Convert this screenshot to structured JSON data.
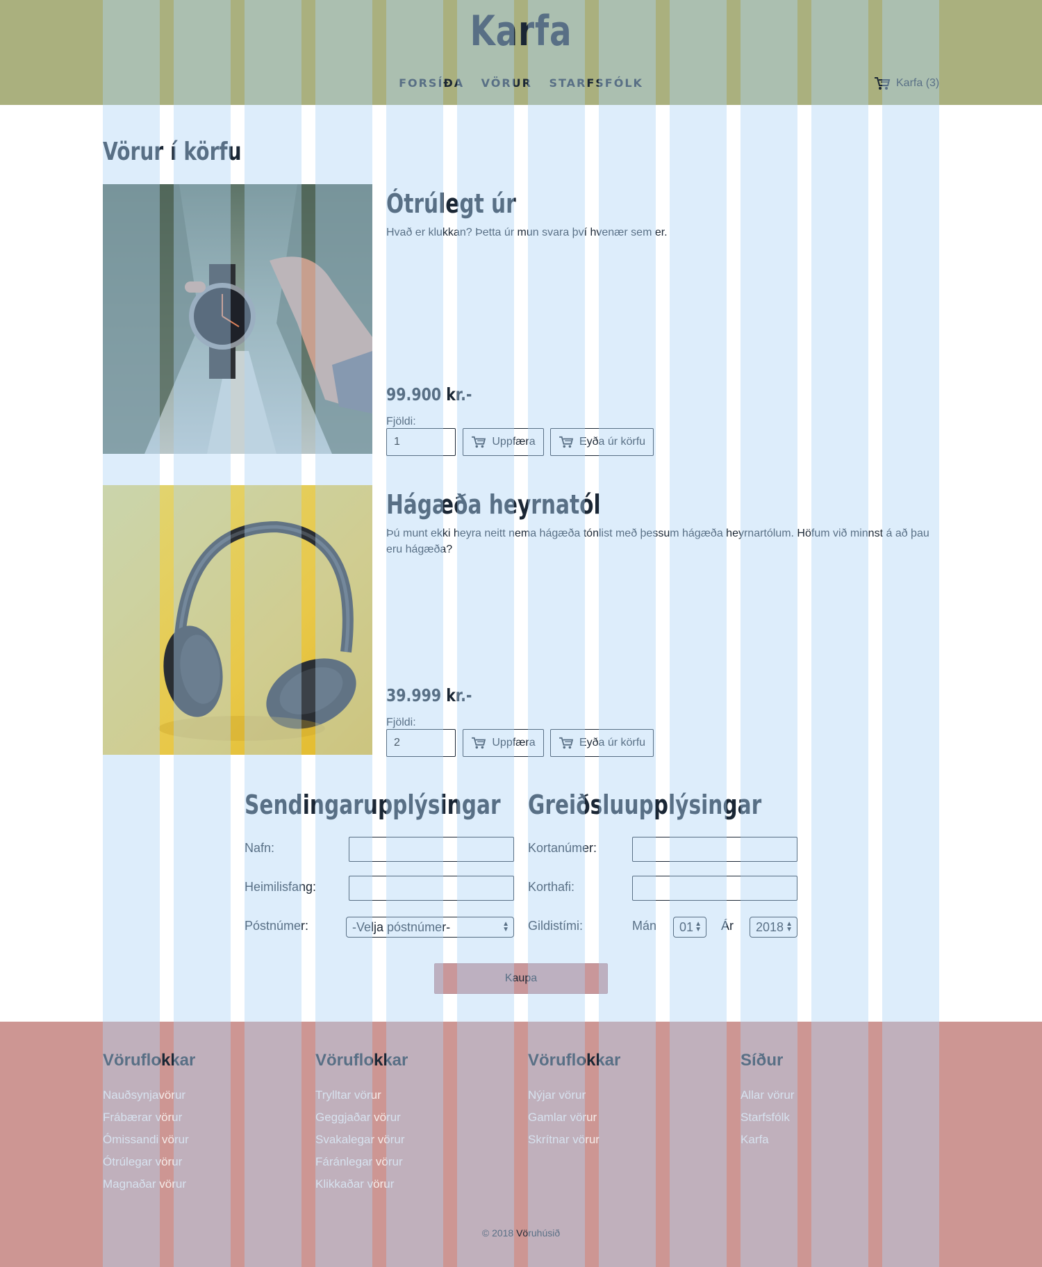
{
  "header": {
    "brand": "Karfa",
    "nav": [
      "FORSÍÐA",
      "VÖRUR",
      "STARFSFÓLK"
    ],
    "cart_label": "Karfa (3)"
  },
  "main": {
    "title": "Vörur í körfu",
    "products": [
      {
        "title": "Ótrúlegt úr",
        "description": "Hvað er klukkan? Þetta úr mun svara því hvenær sem er.",
        "price": "99.900 kr.-",
        "quantity_label": "Fjöldi:",
        "quantity": "1",
        "update_label": "Uppfæra",
        "remove_label": "Eyða úr körfu"
      },
      {
        "title": "Hágæða heyrnatól",
        "description": "Þú munt ekki heyra neitt nema hágæða tónlist með þessum hágæða heyrnartólum. Höfum við minnst á að þau eru hágæða?",
        "price": "39.999 kr.-",
        "quantity_label": "Fjöldi:",
        "quantity": "2",
        "update_label": "Uppfæra",
        "remove_label": "Eyða úr körfu"
      }
    ]
  },
  "shipping": {
    "title": "Sendingarupplýsingar",
    "name_label": "Nafn:",
    "address_label": "Heimilisfang:",
    "postcode_label": "Póstnúmer:",
    "postcode_value": "-Velja póstnúmer-"
  },
  "payment": {
    "title": "Greiðsluupplýsingar",
    "card_number_label": "Kortanúmer:",
    "card_holder_label": "Korthafi:",
    "expiry_label": "Gildistími:",
    "month_label": "Mán",
    "month_value": "01",
    "year_label": "Ár",
    "year_value": "2018"
  },
  "buy_label": "Kaupa",
  "footer": {
    "columns": [
      {
        "title": "Vöruflokkar",
        "links": [
          "Nauðsynjavörur",
          "Frábærar vörur",
          "Ómissandi vörur",
          "Ótrúlegar vörur",
          "Magnaðar vörur"
        ]
      },
      {
        "title": "Vöruflokkar",
        "links": [
          "Trylltar vörur",
          "Geggjaðar vörur",
          "Svakalegar vörur",
          "Fáránlegar vörur",
          "Klikkaðar vörur"
        ]
      },
      {
        "title": "Vöruflokkar",
        "links": [
          "Nýjar vörur",
          "Gamlar vörur",
          "Skrítnar vörur"
        ]
      },
      {
        "title": "Síður",
        "links": [
          "Allar vörur",
          "Starfsfólk",
          "Karfa"
        ]
      }
    ],
    "copyright": "© 2018 Vöruhúsið"
  },
  "colors": {
    "header_bg": "#aab07e",
    "footer_bg": "#cd9693",
    "buy_button": "#c9979a",
    "text": "#1a2634",
    "grid_overlay": "#add4f5"
  },
  "icons": {
    "cart": "cart-icon"
  }
}
